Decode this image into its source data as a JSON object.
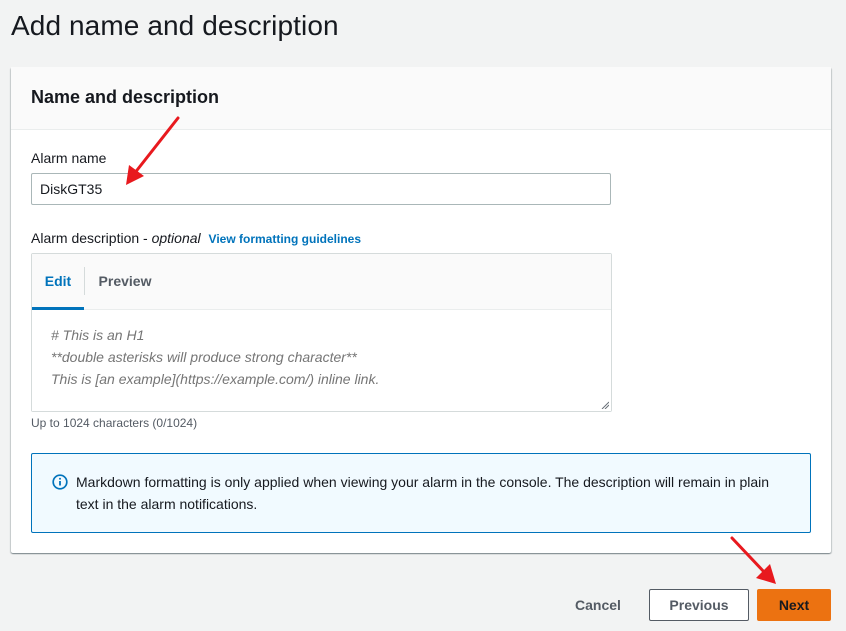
{
  "page_title": "Add name and description",
  "panel": {
    "title": "Name and description"
  },
  "alarm_name": {
    "label": "Alarm name",
    "value": "DiskGT35"
  },
  "alarm_description": {
    "label": "Alarm description - ",
    "optional": "optional",
    "link": "View formatting guidelines",
    "tabs": [
      "Edit",
      "Preview"
    ],
    "active_tab": "Edit",
    "placeholder": "# This is an H1\n**double asterisks will produce strong character**\nThis is [an example](https://example.com/) inline link.",
    "hint": "Up to 1024 characters (0/1024)"
  },
  "info": {
    "icon": "info-icon",
    "text": "Markdown formatting is only applied when viewing your alarm in the console. The description will remain in plain text in the alarm notifications."
  },
  "footer": {
    "cancel": "Cancel",
    "previous": "Previous",
    "next": "Next"
  },
  "colors": {
    "accent": "#0073bb",
    "primary_button": "#ec7211",
    "annotation_arrow": "#e8191e"
  }
}
